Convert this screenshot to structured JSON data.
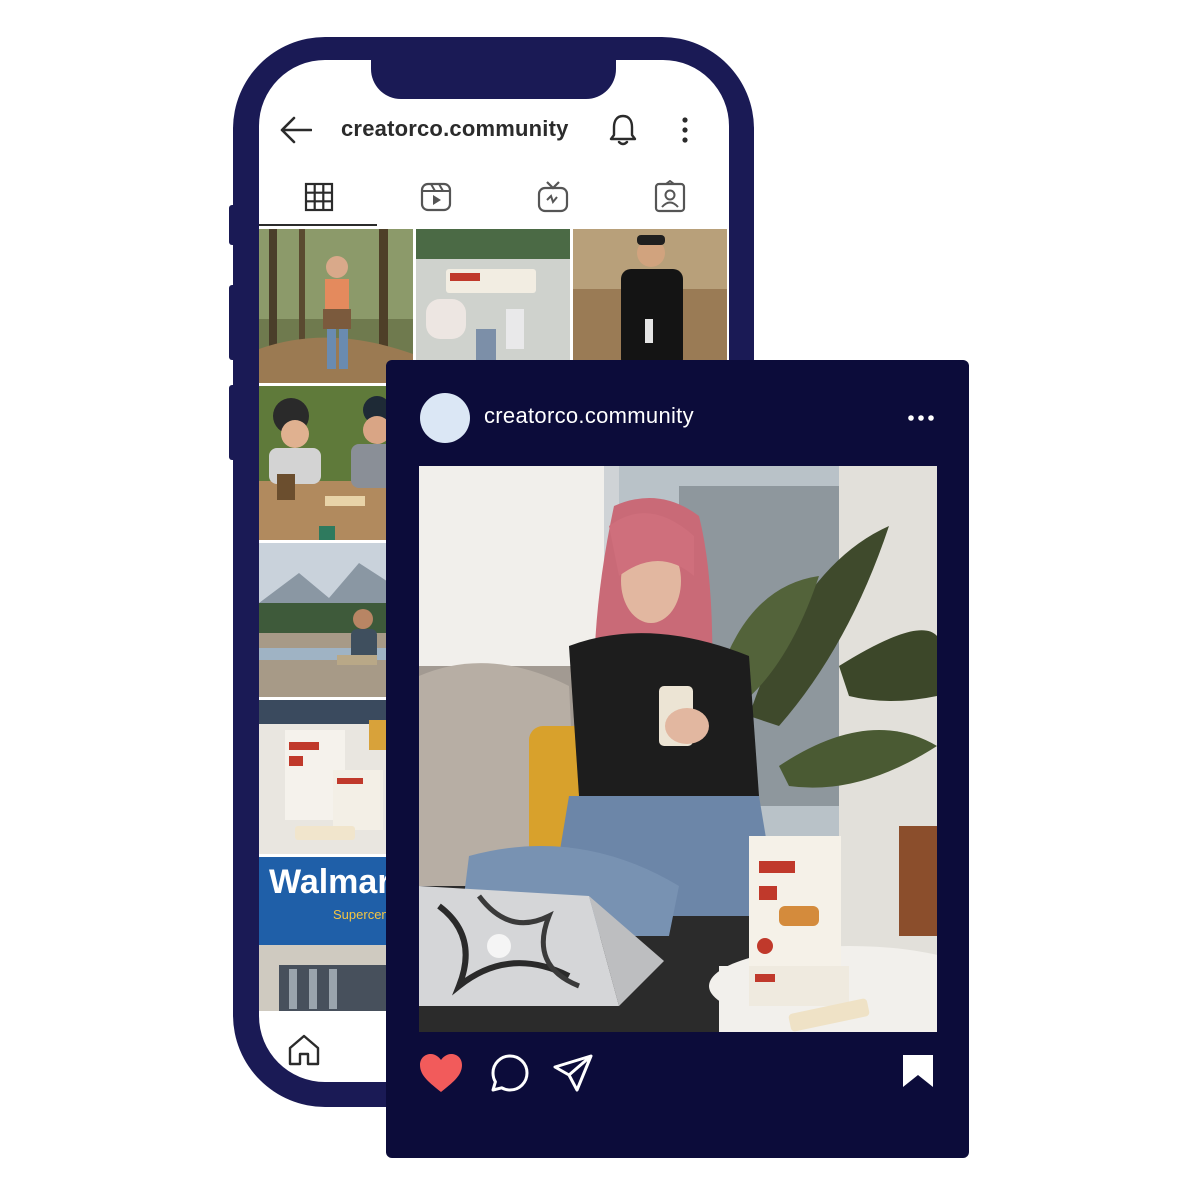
{
  "profile": {
    "username": "creatorco.community"
  },
  "tabs": [
    {
      "icon": "grid-icon",
      "selected": true
    },
    {
      "icon": "reels-icon",
      "selected": false
    },
    {
      "icon": "igtv-icon",
      "selected": false
    },
    {
      "icon": "tagged-icon",
      "selected": false
    }
  ],
  "grid_texts": {
    "store_sign": "Walmart",
    "store_sub": "Supercenter"
  },
  "post": {
    "username": "creatorco.community",
    "liked": true
  },
  "colors": {
    "phone_frame": "#1a1a55",
    "post_background": "#0c0c3a",
    "like_red": "#f25b5b",
    "avatar_fill": "#dbe7f5"
  }
}
